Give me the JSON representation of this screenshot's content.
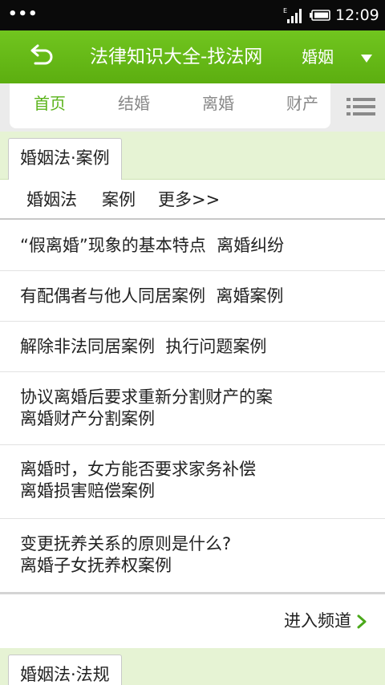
{
  "status_bar": {
    "dots": "•••",
    "signal_icon": "signal-bars-icon",
    "battery_icon": "battery-icon",
    "time": "12:09"
  },
  "app_bar": {
    "back_icon": "back-arrow-icon",
    "title": "法律知识大全-找法网",
    "category": "婚姻",
    "dropdown_icon": "triangle-down-icon",
    "background_color": "#63b516"
  },
  "tabs": {
    "items": [
      {
        "label": "首页",
        "active": true
      },
      {
        "label": "结婚",
        "active": false
      },
      {
        "label": "离婚",
        "active": false
      },
      {
        "label": "财产",
        "active": false
      }
    ],
    "menu_icon": "list-menu-icon",
    "active_color": "#5ab31a"
  },
  "section_cases": {
    "tab_label": "婚姻法·案例",
    "links": [
      "婚姻法",
      "案例",
      "更多>>"
    ],
    "items": [
      {
        "title": "“假离婚”现象的基本特点",
        "category": "离婚纠纷"
      },
      {
        "title": "有配偶者与他人同居案例",
        "category": "离婚案例"
      },
      {
        "title": "解除非法同居案例",
        "category": "执行问题案例"
      },
      {
        "title": "协议离婚后要求重新分割财产的案",
        "category": "离婚财产分割案例"
      },
      {
        "title": "离婚时，女方能否要求家务补偿",
        "category": "离婚损害赔偿案例"
      },
      {
        "title": "变更抚养关系的原则是什么?",
        "category": "离婚子女抚养权案例"
      }
    ],
    "enter_label": "进入频道",
    "enter_icon": "chevron-right-icon"
  },
  "section_laws": {
    "tab_label": "婚姻法·法规"
  }
}
